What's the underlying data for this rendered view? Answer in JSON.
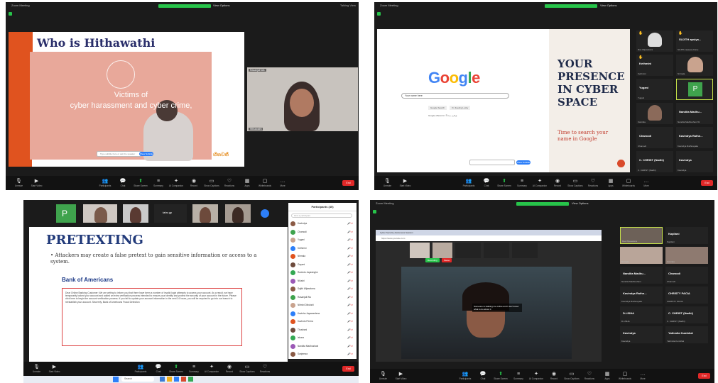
{
  "toolbar": {
    "items": [
      "Unmute",
      "Start Video",
      "Participants",
      "Chat",
      "Share Screen",
      "Summary",
      "AI Companion",
      "Record",
      "Show Captions",
      "Reactions",
      "Apps",
      "Whiteboards",
      "More"
    ],
    "end_label": "End"
  },
  "panel1": {
    "meeting_title": "Zoom Meeting",
    "view_label": "View Options",
    "view_opts": "Talking  View",
    "slide_title": "Who is Hithawathi",
    "slide_text_line1": "Victims of",
    "slide_text_line2": "cyber harassment and cyber crime,",
    "slide_logo": "හිතවතී",
    "subtitle_bar": "Type subtitle here or ask the speaker",
    "subtitle_btn": "Show Subtitle",
    "speaker_name": "Hithawathi",
    "speaker_name_top": "Rasanjali Wa"
  },
  "panel2": {
    "meeting_title": "Zoom Meeting",
    "view_label": "View Options",
    "search_text": "Your name here",
    "google_btn1": "Google Search",
    "google_btn2": "I'm Feeling Lucky",
    "google_links": "Google offered in: සිංහල  தமிழ்",
    "presence_line1": "YOUR",
    "presence_line2": "PRESENCE",
    "presence_line3": "IN CYBER",
    "presence_line4": "SPACE",
    "search_name_line1": "Time to search your",
    "search_name_line2": "name in Google",
    "subtitle_btn": "Show Subtitle",
    "gallery": [
      {
        "name": "",
        "sub": "Ras Wijesekera"
      },
      {
        "name": "SUJITH apsiya...",
        "sub": "SUJITH apsiya (Care)"
      },
      {
        "name": "Kethmini",
        "sub": "Kethmini"
      },
      {
        "name": "",
        "sub": "Nirmala"
      },
      {
        "name": "Yugani",
        "sub": "Yugani"
      },
      {
        "name": "P",
        "sub": ""
      },
      {
        "name": "",
        "sub": "Kavinda"
      },
      {
        "name": "Nandita Madhu...",
        "sub": "Nandita Madhushani W"
      },
      {
        "name": "Chamodi",
        "sub": "Chamodi"
      },
      {
        "name": "Kavindya Rathn...",
        "sub": "Kavindya Rathnayake"
      },
      {
        "name": "C. CHRIST (Nadhi)",
        "sub": "C. CHRIST (Nadhi)"
      },
      {
        "name": "Kavindya",
        "sub": "Kavindya"
      }
    ]
  },
  "panel3": {
    "strip_name": "tabs gp",
    "slide_title": "PRETEXTING",
    "bullet": "• Attackers may create a false pretext to gain sensitive information or access to a system.",
    "bank": "Bank of Americans",
    "letter_body": "Dear Online Banking Customer: We are writing to inform you that there have been a number of invalid login attempts to access your account. As a result, we have temporarily locked your account and added an extra verification process intended to ensure your identity and protect the security of your account in the future. Please click here to begin the account verification process. If you fail to update your account information in the next 24 hours, you will be required to go into our branch to reestablish your account. Sincerely, Bank of Americans Fraud Detection",
    "participants_header": "Participants (45)",
    "search_placeholder": "Find a participant",
    "participants": [
      "Kavindya",
      "Chamodi",
      "Yugani",
      "Kethmini",
      "Nirmala",
      "Gayani",
      "Ravindu Jayasinghe",
      "Nilushi",
      "Sajith Wijesekera",
      "Rasanjali Wa",
      "Nilmini Dilrukshi",
      "Kavisha Jayawardena",
      "Kavindu Perera",
      "Thushani",
      "Ishara",
      "Nandita Madhushani",
      "Sanjeewa"
    ],
    "pl_btn1": "Invite",
    "pl_btn2": "Unmute All",
    "pl_btn3": "Mute All",
    "taskbar_search": "Search",
    "share_btn": "Stop Share"
  },
  "panel4": {
    "meeting_title": "Zoom Meeting",
    "view_label": "View Options",
    "btab_text": "Cyber Security Awareness Session",
    "url_text": "https://www.youtube.com",
    "caption_text": "Someone is stalking me online and I don't know what to do about it",
    "chip1": "Recording",
    "chip2": "Pause",
    "gallery": [
      {
        "name": "",
        "sub": "Ras Wijesekera"
      },
      {
        "name": "Kapilani",
        "sub": "Kapilani"
      },
      {
        "name": "",
        "sub": "Nirmala"
      },
      {
        "name": "",
        "sub": "Kavinda"
      },
      {
        "name": "Nandita Madhu...",
        "sub": "Nandita Madhushani"
      },
      {
        "name": "Chamodi",
        "sub": "Chamodi"
      },
      {
        "name": "Kavindya Rathn...",
        "sub": "Kavindya Rathnayake"
      },
      {
        "name": "CHRISTY PACIA",
        "sub": "CHRISTY PACIA"
      },
      {
        "name": "D.LISHA",
        "sub": "D.LISHA"
      },
      {
        "name": "C. CHRIST (Nadhi)",
        "sub": "C. CHRIST (Nadhi)"
      },
      {
        "name": "Kavindya",
        "sub": "Kavindya"
      },
      {
        "name": "Yathmila Kumbhal",
        "sub": "Yathmila Kumbhal"
      }
    ]
  },
  "colors": {
    "zoom_green": "#27c44a",
    "end_red": "#e02828",
    "slide_orange": "#e0531f",
    "navy": "#2b2f6b"
  }
}
